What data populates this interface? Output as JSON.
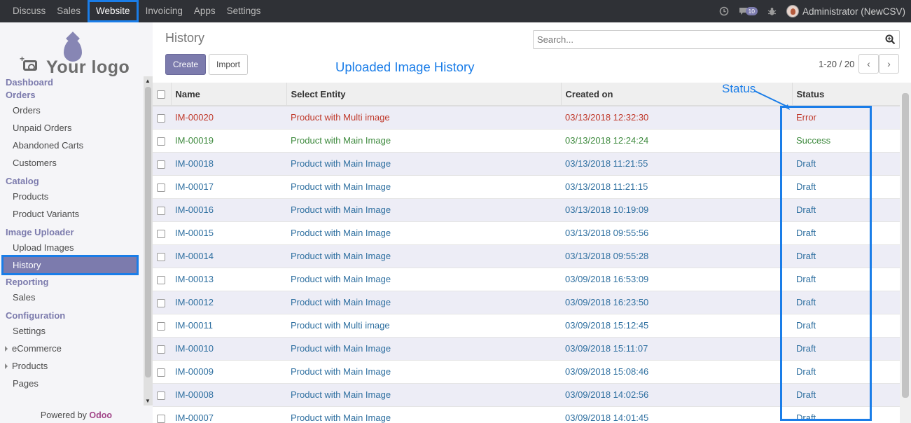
{
  "topbar": {
    "menu": [
      "Discuss",
      "Sales",
      "Website",
      "Invoicing",
      "Apps",
      "Settings"
    ],
    "active": "Website",
    "notif_count": "10",
    "user": "Administrator (NewCSV)"
  },
  "sidebar": {
    "logo_text": "Your logo",
    "sections": [
      {
        "heading": "Dashboard",
        "items": []
      },
      {
        "heading": "Orders",
        "items": [
          "Orders",
          "Unpaid Orders",
          "Abandoned Carts",
          "Customers"
        ]
      },
      {
        "heading": "Catalog",
        "items": [
          "Products",
          "Product Variants"
        ]
      },
      {
        "heading": "Image Uploader",
        "items": [
          "Upload Images",
          "History"
        ]
      },
      {
        "heading": "Reporting",
        "items": [
          "Sales"
        ]
      },
      {
        "heading": "Configuration",
        "items": [
          "Settings"
        ]
      }
    ],
    "collapsible": [
      "eCommerce",
      "Products"
    ],
    "pages": "Pages",
    "powered_by": "Powered by",
    "powered_brand": "Odoo"
  },
  "main": {
    "title": "History",
    "create_label": "Create",
    "import_label": "Import",
    "annotation_title": "Uploaded Image History",
    "annotation_status": "Status",
    "search_placeholder": "Search...",
    "pager": "1-20 / 20",
    "columns": [
      "Name",
      "Select Entity",
      "Created on",
      "Status"
    ],
    "rows": [
      {
        "name": "IM-00020",
        "entity": "Product with Multi image",
        "created": "03/13/2018 12:32:30",
        "status": "Error"
      },
      {
        "name": "IM-00019",
        "entity": "Product with Main Image",
        "created": "03/13/2018 12:24:24",
        "status": "Success"
      },
      {
        "name": "IM-00018",
        "entity": "Product with Main Image",
        "created": "03/13/2018 11:21:55",
        "status": "Draft"
      },
      {
        "name": "IM-00017",
        "entity": "Product with Main Image",
        "created": "03/13/2018 11:21:15",
        "status": "Draft"
      },
      {
        "name": "IM-00016",
        "entity": "Product with Main Image",
        "created": "03/13/2018 10:19:09",
        "status": "Draft"
      },
      {
        "name": "IM-00015",
        "entity": "Product with Main Image",
        "created": "03/13/2018 09:55:56",
        "status": "Draft"
      },
      {
        "name": "IM-00014",
        "entity": "Product with Main Image",
        "created": "03/13/2018 09:55:28",
        "status": "Draft"
      },
      {
        "name": "IM-00013",
        "entity": "Product with Main Image",
        "created": "03/09/2018 16:53:09",
        "status": "Draft"
      },
      {
        "name": "IM-00012",
        "entity": "Product with Main Image",
        "created": "03/09/2018 16:23:50",
        "status": "Draft"
      },
      {
        "name": "IM-00011",
        "entity": "Product with Multi image",
        "created": "03/09/2018 15:12:45",
        "status": "Draft"
      },
      {
        "name": "IM-00010",
        "entity": "Product with Main Image",
        "created": "03/09/2018 15:11:07",
        "status": "Draft"
      },
      {
        "name": "IM-00009",
        "entity": "Product with Main Image",
        "created": "03/09/2018 15:08:46",
        "status": "Draft"
      },
      {
        "name": "IM-00008",
        "entity": "Product with Main Image",
        "created": "03/09/2018 14:02:56",
        "status": "Draft"
      },
      {
        "name": "IM-00007",
        "entity": "Product with Main Image",
        "created": "03/09/2018 14:01:45",
        "status": "Draft"
      }
    ]
  },
  "colors": {
    "brand": "#7c7bad",
    "annotation": "#1a7de8",
    "draft": "#2e6fa0",
    "error": "#c0392b",
    "success": "#3e8a3e"
  }
}
